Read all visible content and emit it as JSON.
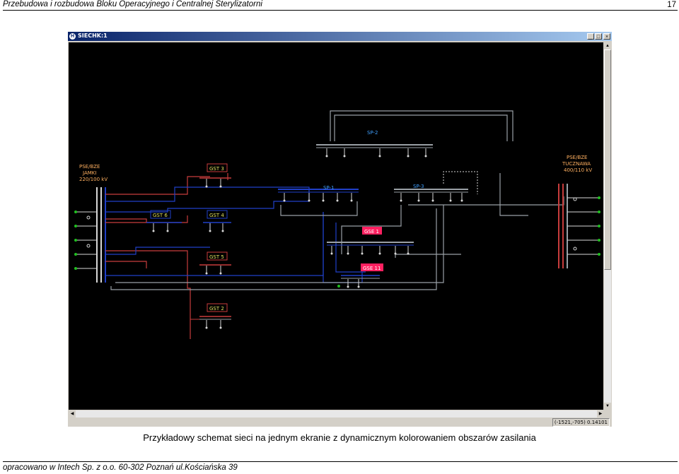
{
  "header": {
    "title": "Przebudowa i rozbudowa Bloku Operacyjnego i Centralnej Sterylizatorni",
    "page_number": "17"
  },
  "window": {
    "title": "SIECHK:1",
    "icon_label": "H",
    "minimize_glyph": "_",
    "maximize_glyph": "□",
    "close_glyph": "×",
    "status_coords": "(-1521,-705) 0.14101"
  },
  "schematic": {
    "left_source": [
      "PSE/BZE",
      "JAMKI",
      "220/100 kV"
    ],
    "right_source": [
      "PSE/BZE",
      "TUCZNAWA",
      "400/110 kV"
    ],
    "stations": {
      "gst3": "GST 3",
      "gst6": "GST 6",
      "gst4": "GST 4",
      "gst5": "GST 5",
      "gst2": "GST 2",
      "sp1": "SP-1",
      "sp2": "SP-2",
      "sp3": "SP-3",
      "gse1": "GSE 1",
      "gse11": "GSE 11"
    }
  },
  "caption": "Przykładowy schemat sieci na jednym ekranie z dynamicznym kolorowaniem obszarów zasilania",
  "footer": "opracowano w Intech Sp. z o.o. 60-302 Poznań ul.Kościańska 39",
  "colors": {
    "background": "#000000",
    "red_network": "#c83c3c",
    "blue_network": "#2040c8",
    "grey_network": "#9aa0a6",
    "feeder": "#d8d8d8",
    "label_yellow": "#e0e060",
    "label_orange": "#ffb060",
    "label_blue": "#40a0ff",
    "gse_fill": "#ff2060"
  }
}
